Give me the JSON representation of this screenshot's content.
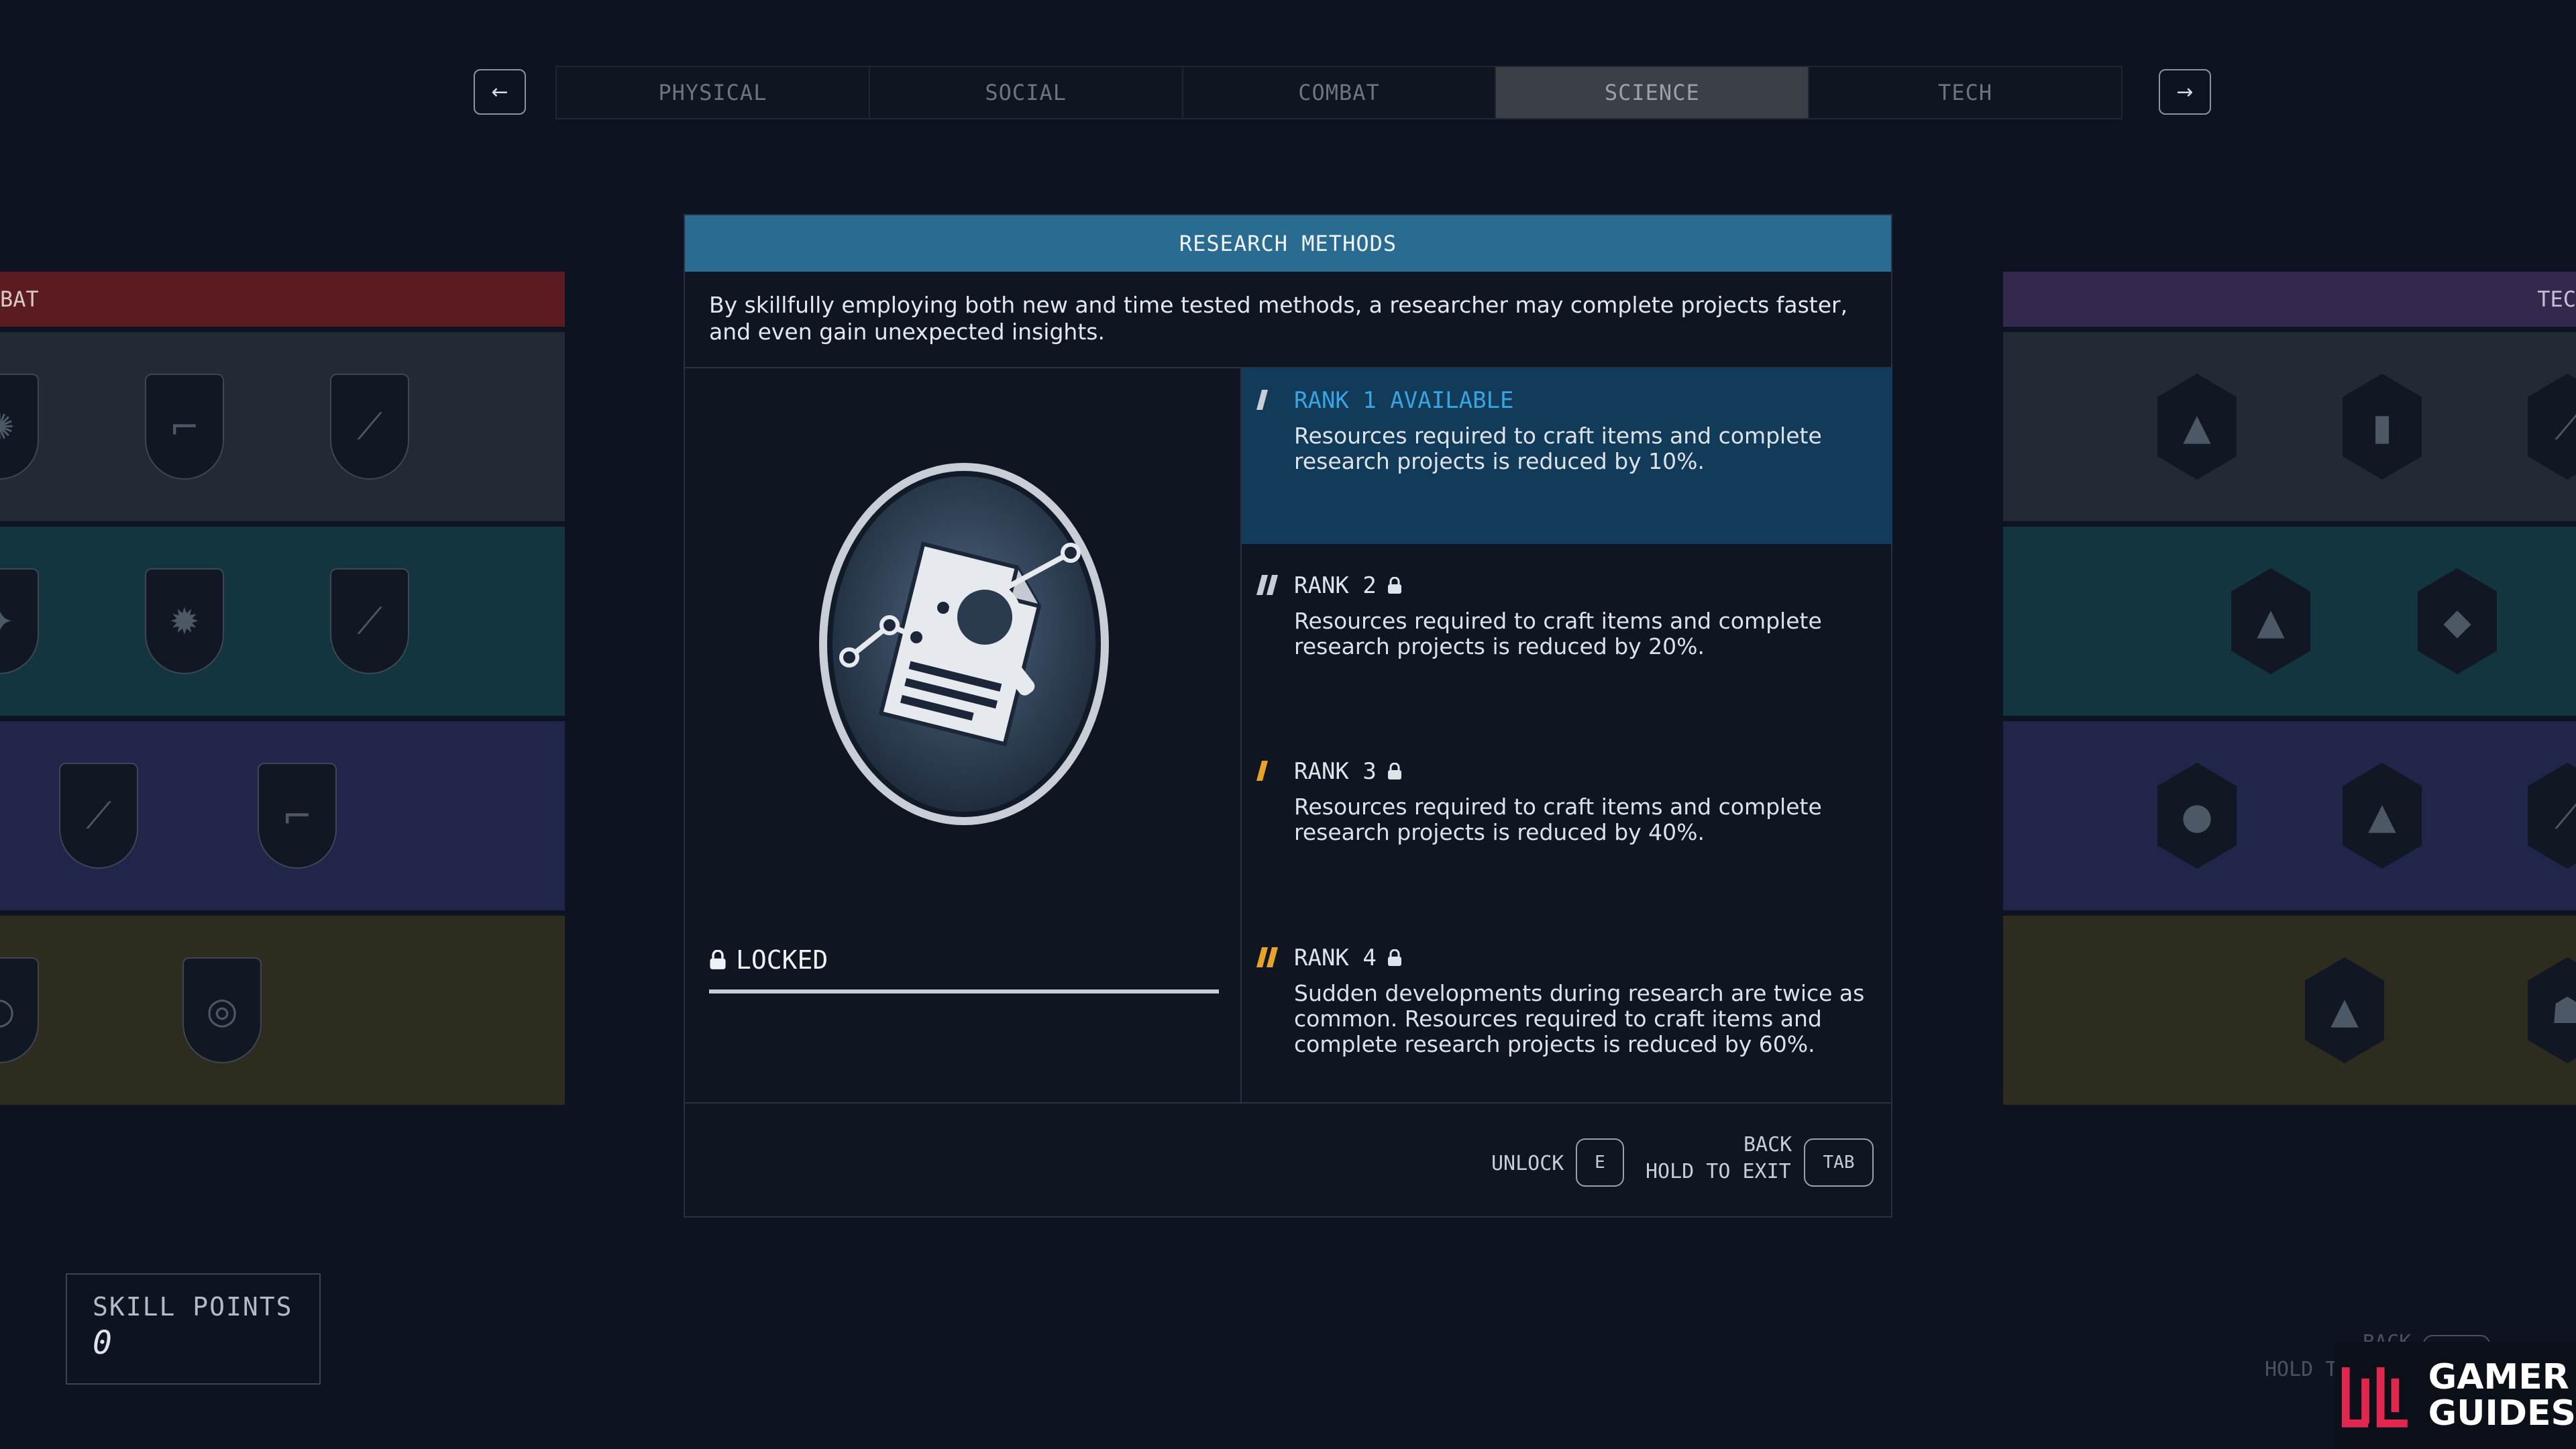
{
  "nav": {
    "prev_icon": "←",
    "next_icon": "→"
  },
  "tabs": [
    {
      "label": "PHYSICAL",
      "active": false
    },
    {
      "label": "SOCIAL",
      "active": false
    },
    {
      "label": "COMBAT",
      "active": false
    },
    {
      "label": "SCIENCE",
      "active": true
    },
    {
      "label": "TECH",
      "active": false
    }
  ],
  "left_panel": {
    "header": "BAT",
    "color": "#5a1c20"
  },
  "right_panel": {
    "header": "TEC",
    "color": "#34284c"
  },
  "modal": {
    "title": "RESEARCH METHODS",
    "description": "By skillfully employing both new and time tested methods, a researcher may complete projects faster, and even gain unexpected insights.",
    "status": "LOCKED",
    "icon": "research-document-magnifier-icon",
    "ranks": [
      {
        "title": "RANK 1 AVAILABLE",
        "description": "Resources required to craft items and complete research projects is reduced by 10%.",
        "available": true,
        "marker_color": "#c9ced6"
      },
      {
        "title": "RANK 2",
        "description": "Resources required to craft items and complete research projects is reduced by 20%.",
        "available": false,
        "marker_color": "#c9ced6"
      },
      {
        "title": "RANK 3",
        "description": "Resources required to craft items and complete research projects is reduced by 40%.",
        "available": false,
        "marker_color": "#e8a22a"
      },
      {
        "title": "RANK 4",
        "description": "Sudden developments during research are twice as common. Resources required to craft items and complete research projects is reduced by 60%.",
        "available": false,
        "marker_color": "#e8a22a"
      }
    ],
    "footer": {
      "unlock_label": "UNLOCK",
      "unlock_key": "E",
      "back_label": "BACK",
      "exit_label": "HOLD TO EXIT",
      "back_key": "TAB"
    }
  },
  "skill_points": {
    "label": "SKILL POINTS",
    "value": "0"
  },
  "background_hint": {
    "back_label": "BACK",
    "hold_label": "HOLD T",
    "key": "TAB"
  },
  "watermark": {
    "line1": "GAMER",
    "line2": "GUIDES",
    "accent": "#e0284f"
  }
}
